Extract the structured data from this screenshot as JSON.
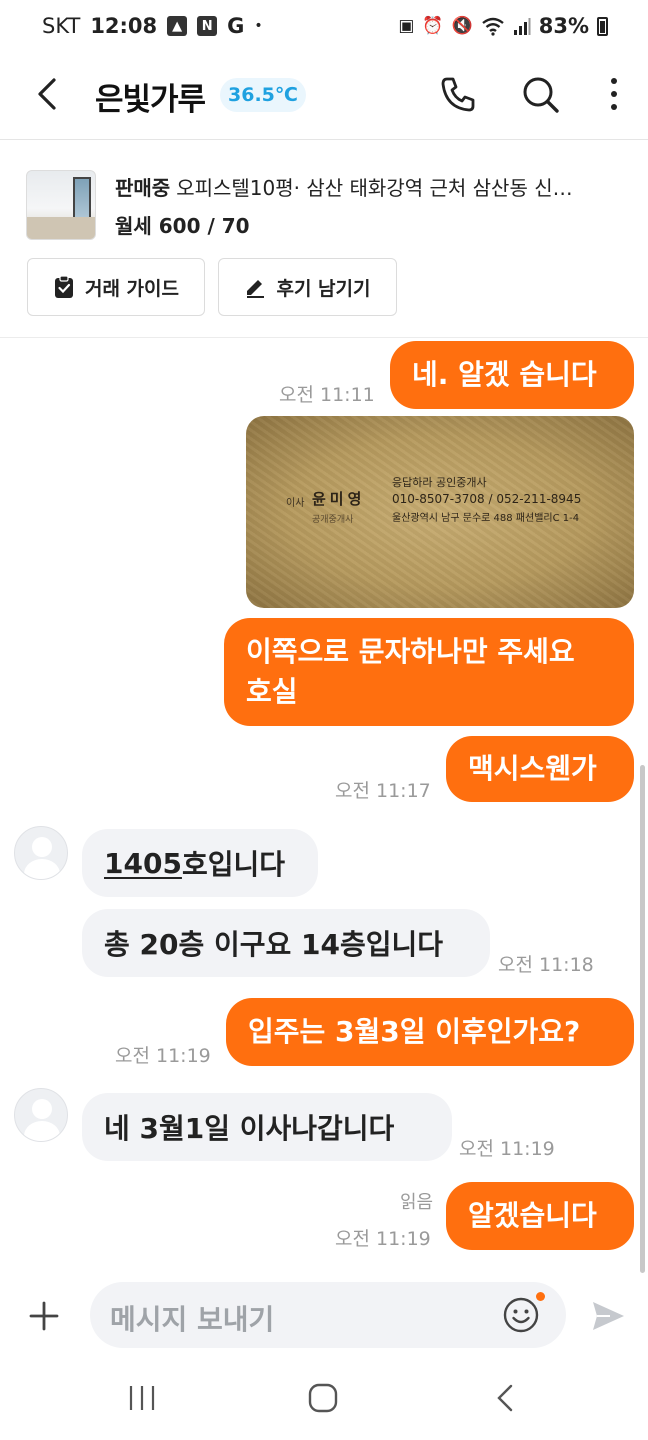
{
  "status_bar": {
    "carrier": "SKT",
    "time": "12:08",
    "notif_n": "N",
    "notif_g": "G",
    "dot": "•",
    "battery_pct": "83%"
  },
  "header": {
    "title": "은빛가루",
    "manner_temp": "36.5℃"
  },
  "product": {
    "status": "판매중",
    "title": "오피스텔10평· 삼산 태화강역 근처 삼산동 신…",
    "price": "월세 600 / 70",
    "guide_label": "거래 가이드",
    "review_label": "후기 남기기"
  },
  "business_card": {
    "role": "이사",
    "name": "윤미영",
    "subtitle": "공개중개사",
    "office": "응답하라 공인중개사",
    "phones": "010-8507-3708 / 052-211-8945",
    "address": "울산광역시 남구 문수로 488 패션밸리C 1-4"
  },
  "messages": [
    {
      "id": "m1",
      "side": "out",
      "text": "네. 알겠 습니다",
      "time": "오전 11:11"
    },
    {
      "id": "m2",
      "side": "out",
      "type": "image",
      "time": ""
    },
    {
      "id": "m3",
      "side": "out",
      "line1": "이쪽으로 문자하나만 주세요",
      "line2": "호실"
    },
    {
      "id": "m4",
      "side": "out",
      "text": "맥시스웬가",
      "time": "오전 11:17"
    },
    {
      "id": "m5",
      "side": "in",
      "text_underlined": "1405",
      "text_rest": "호입니다"
    },
    {
      "id": "m6",
      "side": "in",
      "text": "총 20층 이구요 14층입니다",
      "time": "오전 11:18"
    },
    {
      "id": "m7",
      "side": "out",
      "text": "입주는 3월3일 이후인가요?",
      "time": "오전 11:19"
    },
    {
      "id": "m8",
      "side": "in",
      "text": "네  3월1일 이사나갑니다",
      "time": "오전 11:19"
    },
    {
      "id": "m9",
      "side": "out",
      "text": "알겠습니다",
      "time": "오전 11:19",
      "read_label": "읽음"
    }
  ],
  "input": {
    "placeholder": "메시지 보내기"
  },
  "colors": {
    "accent": "#ff6f0f",
    "incoming_bubble": "#f2f3f6",
    "temp_text": "#1fa1e0"
  },
  "icons": [
    "back-arrow-icon",
    "phone-icon",
    "search-icon",
    "more-vert-icon",
    "clipboard-check-icon",
    "pencil-icon",
    "plus-icon",
    "emoji-icon",
    "send-icon",
    "recent-apps-icon",
    "home-icon",
    "nav-back-icon"
  ]
}
